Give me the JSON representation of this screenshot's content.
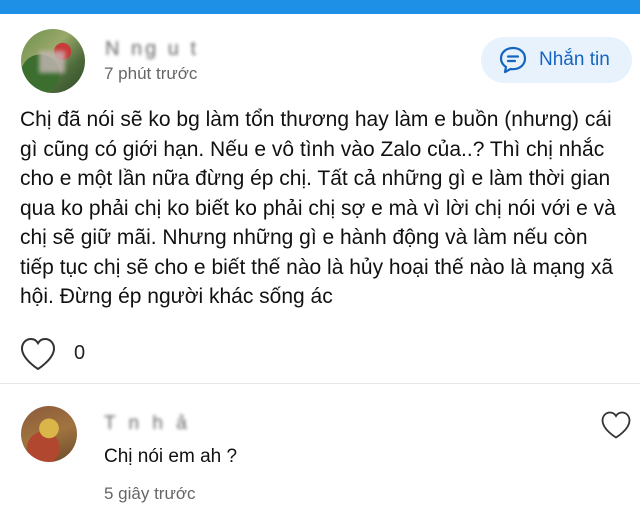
{
  "post": {
    "author_name": "N ng u t",
    "time": "7 phút trước",
    "message_button_label": "Nhắn tin",
    "text": "Chị đã nói sẽ ko bg làm tổn thương hay làm e buồn (nhưng) cái gì cũng có giới hạn. Nếu e vô tình vào Zalo của..? Thì chị nhắc cho e một lần nữa đừng ép chị. Tất cả những gì e làm thời gian qua ko phải chị ko biết ko phải chị sợ e mà vì lời chị nói với e và chị sẽ giữ mãi. Nhưng những gì e hành động và làm nếu còn tiếp tục chị sẽ cho e biết thế nào là hủy hoại thế nào là mạng xã hội. Đừng ép người khác sống ác",
    "like_count": "0"
  },
  "comment": {
    "author_name": "T   n h  ả",
    "text": "Chị nói em ah ?",
    "time": "5 giây trước"
  },
  "colors": {
    "top_bar": "#1e90e6",
    "button_bg": "#e7f2fd",
    "accent": "#1565c0"
  },
  "icons": {
    "message": "chat-bubble-icon",
    "like": "heart-outline-icon"
  }
}
